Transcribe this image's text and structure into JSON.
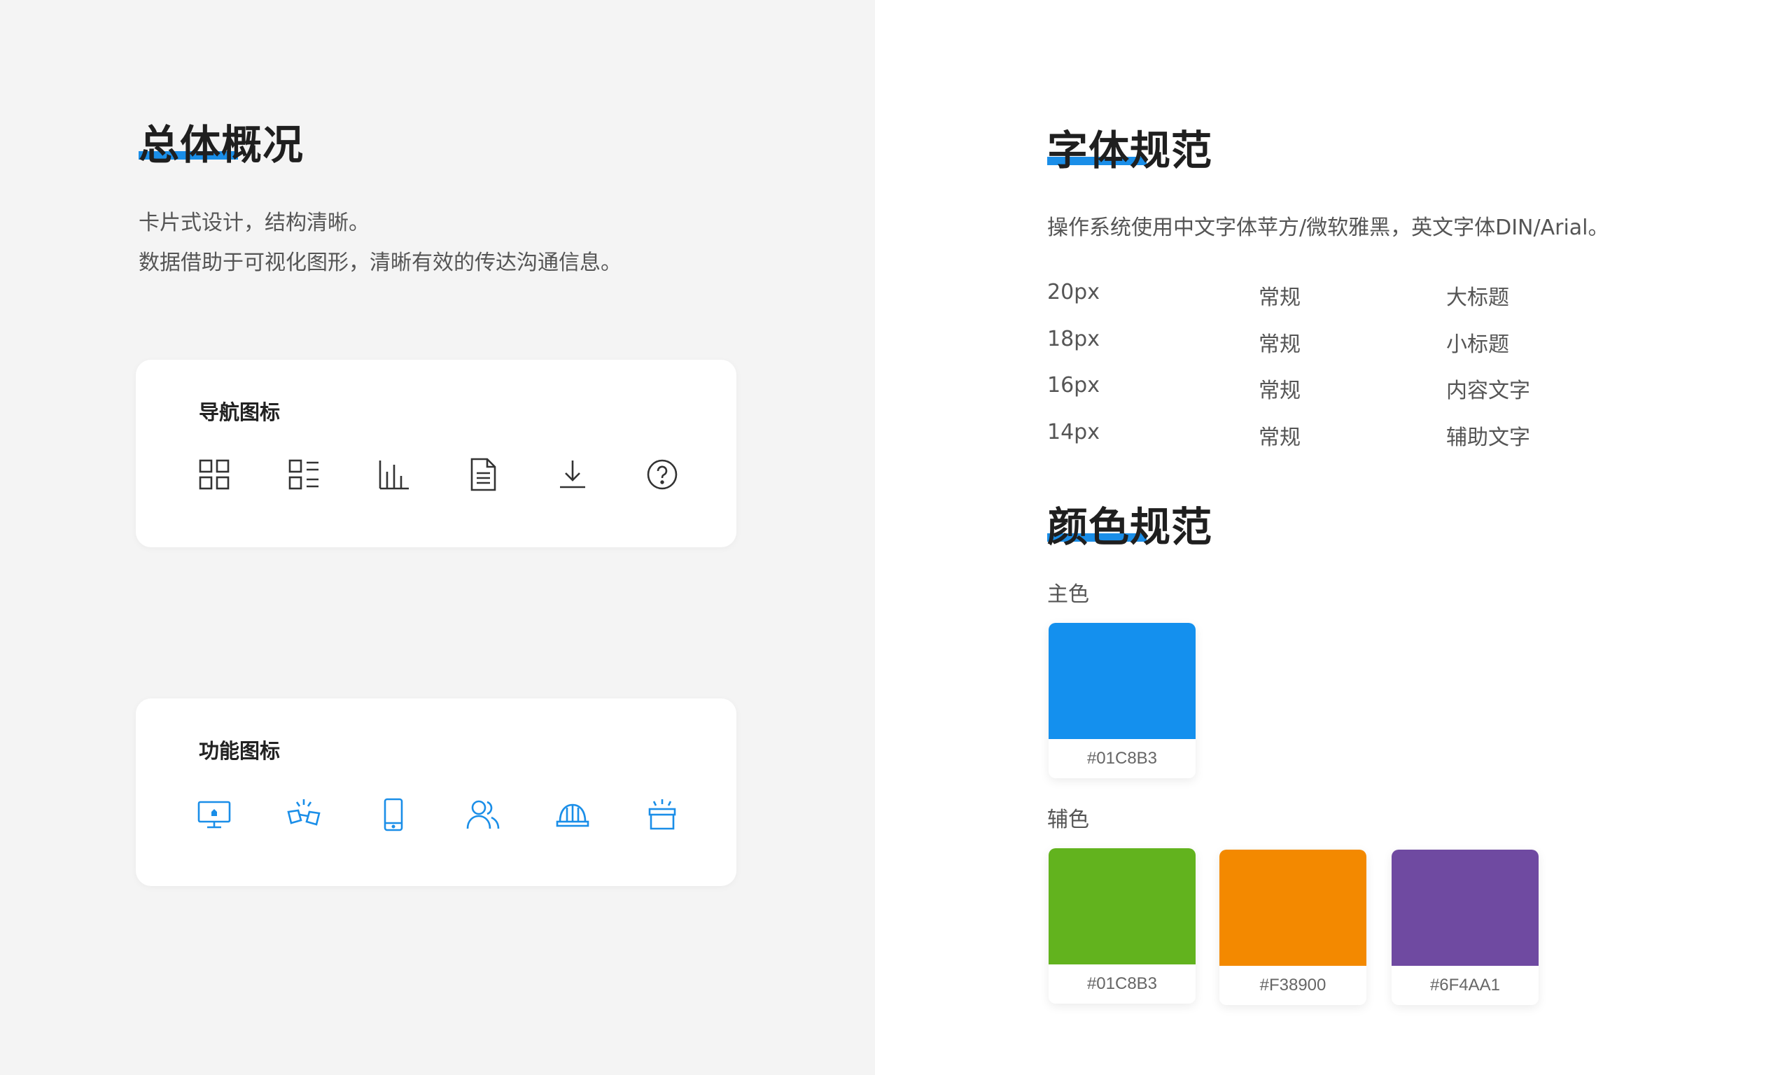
{
  "overview": {
    "title": "总体概况",
    "lines": [
      "卡片式设计，结构清晰。",
      "数据借助于可视化图形，清晰有效的传达沟通信息。"
    ]
  },
  "nav_card": {
    "title": "导航图标",
    "icons": [
      "grid-icon",
      "list-icon",
      "bar-chart-icon",
      "document-icon",
      "download-icon",
      "help-icon"
    ]
  },
  "func_card": {
    "title": "功能图标",
    "icons": [
      "monitor-icon",
      "handshake-icon",
      "mobile-icon",
      "users-icon",
      "helmet-icon",
      "basket-icon"
    ],
    "icon_color": "#1a8ee8"
  },
  "font_spec": {
    "title": "字体规范",
    "desc": "操作系统使用中文字体苹方/微软雅黑，英文字体DIN/Arial。",
    "rows": [
      {
        "size": "20px",
        "weight": "常规",
        "usage": "大标题"
      },
      {
        "size": "18px",
        "weight": "常规",
        "usage": "小标题"
      },
      {
        "size": "16px",
        "weight": "常规",
        "usage": "内容文字"
      },
      {
        "size": "14px",
        "weight": "常规",
        "usage": "辅助文字"
      }
    ]
  },
  "color_spec": {
    "title": "颜色规范",
    "primary_label": "主色",
    "secondary_label": "辅色",
    "primary": [
      {
        "color": "#1490EE",
        "code": "#01C8B3"
      }
    ],
    "secondary": [
      {
        "color": "#62B31E",
        "code": "#01C8B3"
      },
      {
        "color": "#F38900",
        "code": "#F38900"
      },
      {
        "color": "#6F4AA1",
        "code": "#6F4AA1"
      }
    ]
  },
  "accent": "#1a8ee8"
}
